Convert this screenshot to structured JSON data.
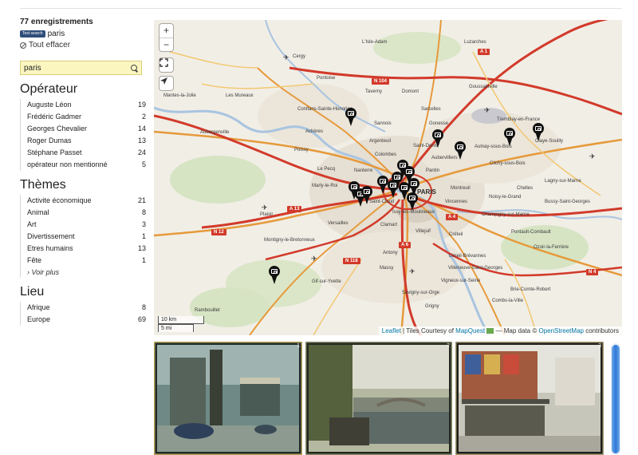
{
  "records": {
    "count_label": "77 enregistrements"
  },
  "active_filter": {
    "badge": "Text search",
    "value": "paris"
  },
  "clear_all": "Tout effacer",
  "search": {
    "value": "paris",
    "placeholder": ""
  },
  "facets": {
    "operateur": {
      "title": "Opérateur",
      "items": [
        {
          "label": "Auguste Léon",
          "count": "19"
        },
        {
          "label": "Frédéric Gadmer",
          "count": "2"
        },
        {
          "label": "Georges Chevalier",
          "count": "14"
        },
        {
          "label": "Roger Dumas",
          "count": "13"
        },
        {
          "label": "Stéphane Passet",
          "count": "24"
        },
        {
          "label": "opérateur non mentionné",
          "count": "5"
        }
      ]
    },
    "themes": {
      "title": "Thèmes",
      "items": [
        {
          "label": "Activite économique",
          "count": "21"
        },
        {
          "label": "Animal",
          "count": "8"
        },
        {
          "label": "Art",
          "count": "3"
        },
        {
          "label": "Divertissement",
          "count": "1"
        },
        {
          "label": "Etres humains",
          "count": "13"
        },
        {
          "label": "Fête",
          "count": "1"
        }
      ],
      "more": "› Voir plus"
    },
    "lieu": {
      "title": "Lieu",
      "items": [
        {
          "label": "Afrique",
          "count": "8"
        },
        {
          "label": "Europe",
          "count": "69"
        }
      ]
    }
  },
  "map": {
    "zoom_in": "+",
    "zoom_out": "−",
    "scale_km": "10 km",
    "scale_mi": "5 mi",
    "attribution": {
      "leaflet": "Leaflet",
      "tiles_text": "| Tiles Courtesy of",
      "mapquest": "MapQuest",
      "data_text": "— Map data ©",
      "osm": "OpenStreetMap",
      "contributors": "contributors"
    },
    "places": {
      "paris": "PARIS",
      "cergy": "Cergy",
      "pontoise": "Pontoise",
      "isle_adam": "L'Isle-Adam",
      "luzarches": "Luzarches",
      "mantes": "Mantes-la-Jolie",
      "les_mureaux": "Les Mureaux",
      "conflans": "Conflans-Sainte-Honorine",
      "taverny": "Taverny",
      "domont": "Domont",
      "goussainville": "Goussainville",
      "sarcelles": "Sarcelles",
      "aubergenville": "Aubergenville",
      "acheres": "Achères",
      "sannois": "Sannois",
      "gonesse": "Gonesse",
      "tremblay": "Tremblay-en-France",
      "argenteuil": "Argenteuil",
      "poissy": "Poissy",
      "saint_denis": "Saint-Denis",
      "aulnay": "Aulnay-sous-Bois",
      "claye": "Claye-Souilly",
      "colombes": "Colombes",
      "le_pecq": "Le Pecq",
      "nanterre": "Nanterre",
      "aubervilliers": "Aubervilliers",
      "pantin": "Pantin",
      "clichy": "Clichy-sous-Bois",
      "lagny": "Lagny-sur-Marne",
      "marly": "Marly-le-Roi",
      "montreuil": "Montreuil",
      "noisy": "Noisy-le-Grand",
      "chelles": "Chelles",
      "bussy": "Bussy-Saint-Georges",
      "plaisir": "Plaisir",
      "versailles": "Versailles",
      "saint_cloud": "Saint-Cloud",
      "issy": "Issy-les-Moulineaux",
      "vincennes": "Vincennes",
      "champigny": "Champigny-sur-Marne",
      "clamart": "Clamart",
      "villejuif": "Villejuif",
      "creteil": "Créteil",
      "pontault": "Pontault-Combault",
      "montigny": "Montigny-le-Bretonneux",
      "antony": "Antony",
      "limeil": "Limeil-Brévannes",
      "ozoir": "Ozoir-la-Ferrière",
      "massy": "Massy",
      "villeneuve": "Villeneuve-Saint-Georges",
      "gif": "Gif-sur-Yvette",
      "vigneux": "Vigneux-sur-Seine",
      "brie": "Brie-Comte-Robert",
      "savigny": "Savigny-sur-Orge",
      "combs": "Combs-la-Ville",
      "rambouillet": "Rambouillet",
      "grigny": "Grigny"
    },
    "roads": [
      "A 1",
      "N 104",
      "A 13",
      "N 12",
      "A 4",
      "N 118",
      "A 6",
      "N 4"
    ]
  },
  "thumbnails": [
    {
      "number": "1",
      "caption": ""
    },
    {
      "number": "2",
      "caption": ""
    },
    {
      "number": "3",
      "caption": ""
    }
  ],
  "colors": {
    "filter_badge": "#2e4e7a",
    "search_bg": "#fbf6c0",
    "link": "#0078a8",
    "road_red": "#d23a2a",
    "road_orange": "#e69a3b",
    "water": "#a9c4e0",
    "scrollbar": "#2d78d8"
  }
}
